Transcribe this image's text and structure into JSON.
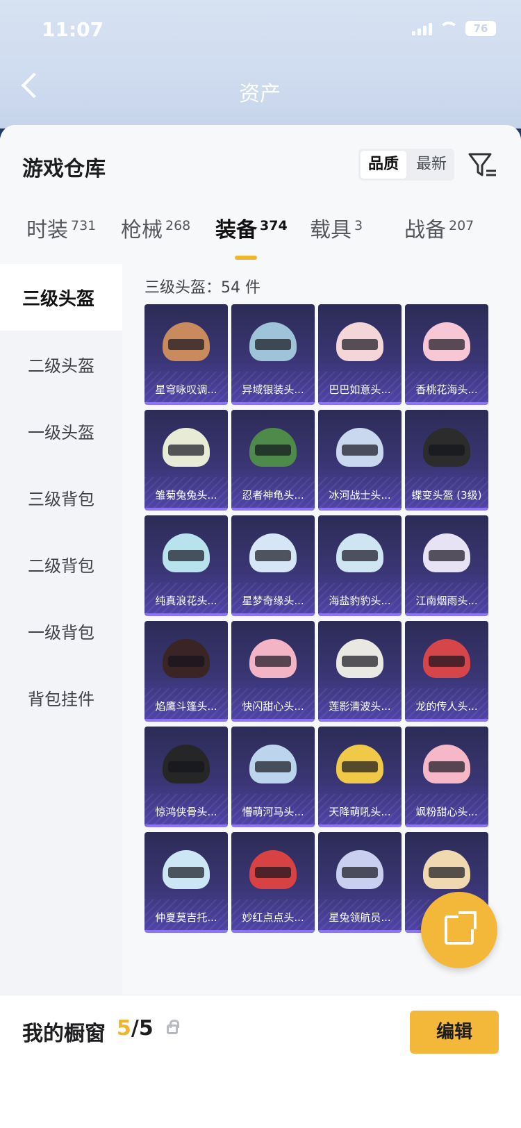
{
  "status": {
    "time": "11:07",
    "battery": "76"
  },
  "nav": {
    "title": "资产"
  },
  "panel": {
    "title": "游戏仓库",
    "sort": [
      "品质",
      "最新"
    ],
    "tabs": [
      {
        "label": "时装",
        "count": "731"
      },
      {
        "label": "枪械",
        "count": "268"
      },
      {
        "label": "装备",
        "count": "374"
      },
      {
        "label": "载具",
        "count": "3"
      },
      {
        "label": "战备",
        "count": "207"
      }
    ]
  },
  "sidebar": [
    "三级头盔",
    "二级头盔",
    "一级头盔",
    "三级背包",
    "二级背包",
    "一级背包",
    "背包挂件"
  ],
  "grid": {
    "count_label": "三级头盔：54 件",
    "items": [
      {
        "name": "星穹咏叹调...",
        "color": "#c98a5e"
      },
      {
        "name": "异域银装头...",
        "color": "#9fc3d8"
      },
      {
        "name": "巴巴如意头...",
        "color": "#f4d6d8"
      },
      {
        "name": "香桃花海头...",
        "color": "#f7c7d6"
      },
      {
        "name": "雏菊兔兔头...",
        "color": "#e8ecd6"
      },
      {
        "name": "忍者神龟头...",
        "color": "#4e8a4a"
      },
      {
        "name": "冰河战士头...",
        "color": "#c9d7ef"
      },
      {
        "name": "蝶变头盔 (3级)",
        "color": "#2c2c2c"
      },
      {
        "name": "纯真浪花头...",
        "color": "#b7e2ee"
      },
      {
        "name": "星梦奇缘头...",
        "color": "#d6e6f6"
      },
      {
        "name": "海盐豹豹头...",
        "color": "#cfe5f1"
      },
      {
        "name": "江南烟雨头...",
        "color": "#e7e2f4"
      },
      {
        "name": "焰鹰斗篷头...",
        "color": "#3a2424"
      },
      {
        "name": "快闪甜心头...",
        "color": "#f3b5c6"
      },
      {
        "name": "莲影清波头...",
        "color": "#eae8e2"
      },
      {
        "name": "龙的传人头...",
        "color": "#d6454a"
      },
      {
        "name": "惊鸿侠骨头...",
        "color": "#262626"
      },
      {
        "name": "懵萌河马头...",
        "color": "#bcd4ec"
      },
      {
        "name": "天降萌吼头...",
        "color": "#f1c949"
      },
      {
        "name": "飒粉甜心头...",
        "color": "#f6b7c8"
      },
      {
        "name": "仲夏莫吉托...",
        "color": "#cde6f5"
      },
      {
        "name": "妙红点点头...",
        "color": "#d94243"
      },
      {
        "name": "星兔领航员...",
        "color": "#c9d0ef"
      },
      {
        "name": "",
        "color": "#f0d9b0"
      }
    ]
  },
  "bottom": {
    "label": "我的橱窗",
    "used": "5",
    "total": "/5",
    "edit": "编辑"
  }
}
